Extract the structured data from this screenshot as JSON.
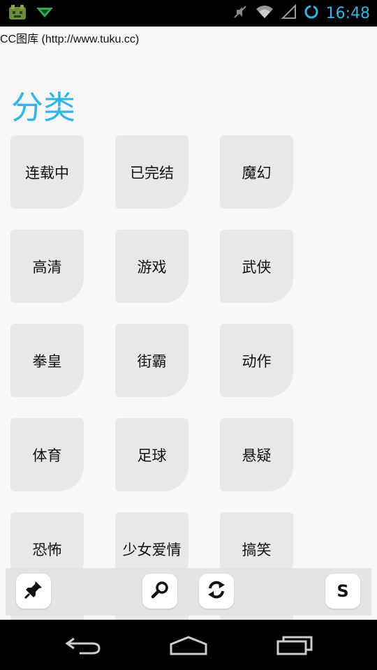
{
  "status_bar": {
    "time": "16:48",
    "icons": [
      "android-app-icon",
      "notification-icon",
      "mute-icon",
      "wifi-icon",
      "signal-icon",
      "sync-icon"
    ]
  },
  "page": {
    "site_title": "CC图库 (http://www.tuku.cc)",
    "section_heading": "分类",
    "categories": [
      "连载中",
      "已完结",
      "魔幻",
      "高清",
      "游戏",
      "武侠",
      "拳皇",
      "街霸",
      "动作",
      "体育",
      "足球",
      "悬疑",
      "恐怖",
      "少女爱情",
      "搞笑",
      "",
      "",
      ""
    ]
  },
  "toolbar": {
    "s_label": "S",
    "icons": [
      "pin-icon",
      "search-icon",
      "refresh-icon"
    ]
  },
  "nav_bar": {
    "icons": [
      "back-icon",
      "home-icon",
      "recents-icon"
    ]
  },
  "colors": {
    "accent": "#33b5e5",
    "tile_bg": "#e8e8e8",
    "page_bg": "#f7f7f7"
  }
}
